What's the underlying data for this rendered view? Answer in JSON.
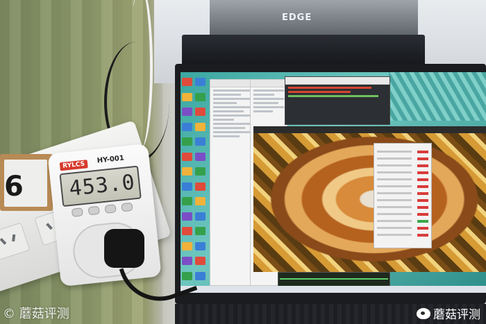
{
  "scene": {
    "pc_label": "EDGE",
    "meter": {
      "brand": "RYLCS",
      "model": "HY-001",
      "reading": "453.0"
    },
    "sign_digit": "6",
    "watermark_left": "©  蘑菇评测",
    "watermark_right": "蘑菇评测"
  },
  "colors": {
    "meter_brand": "#d63a2c",
    "lcd": "#c8c8bc",
    "monitor_bezel": "#1b1c1f"
  }
}
